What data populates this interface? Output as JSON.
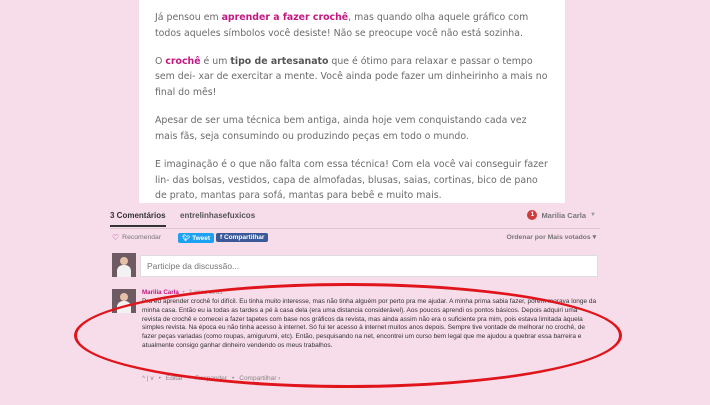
{
  "article": {
    "p1_a": "Já pensou em ",
    "p1_b": "aprender a fazer crochê",
    "p1_c": ", mas quando olha aquele gráfico com todos aqueles símbolos você desiste! Não se preocupe você não está sozinha.",
    "p2_a": "O ",
    "p2_b": "crochê",
    "p2_c": " é um ",
    "p2_d": "tipo de artesanato",
    "p2_e": " que é ótimo para relaxar e passar o tempo sem dei- xar de exercitar a mente. Você ainda pode fazer um dinheirinho a mais no final do mês!",
    "p3": "Apesar de ser uma técnica bem antiga, ainda hoje vem conquistando cada vez mais fãs, seja consumindo ou produzindo peças em todo o mundo.",
    "p4": "E imaginação é o que não falta com essa técnica! Com ela você vai conseguir fazer lin- das bolsas, vestidos, capa de almofadas, blusas, saias, cortinas, bico de pano de prato, mantas para sofá, mantas para bebê e muito mais."
  },
  "comments": {
    "tab_count": "3 Comentários",
    "tab_site": "entrelinhasefuxicos",
    "notif_count": "1",
    "user_name": "Marilia Carla",
    "recommend_label": "Recomendar",
    "tweet_label": "Tweet",
    "share_label": "Compartilhar",
    "sort_label": "Ordenar por Mais votados",
    "compose_placeholder": "Participe da discussão...",
    "comment": {
      "author": "Marilia Carla",
      "time": "2 anos atrás",
      "body": "Pra eu aprender crochê foi difícil. Eu tinha muito interesse, mas não tinha alguém por perto pra me ajudar. A minha prima sabia fazer, porém morava longe da minha casa. Então eu ia todas as tardes a pé à casa dela (era uma distancia considerável). Aos poucos aprendi os pontos básicos. Depois adquiri uma revista de crochê e comecei a fazer tapetes com base nos gráficos da revista, mas ainda assim não era o suficiente pra mim, pois estava limitada àquela simples revista. Na época eu não tinha acesso à internet. Só fui ter acesso à internet muitos anos depois. Sempre tive vontade de melhorar no crochê, de fazer peças variadas (como roupas, amigurumi, etc). Então, pesquisando na net, encontrei um curso bem legal que me ajudou a quebrar essa barreira e atualmente consigo ganhar dinheiro vendendo os meus trabalhos.",
      "votes": "^ | v",
      "edit_label": "Editar",
      "reply_label": "Responder",
      "share_label": "Compartilhar ›"
    }
  },
  "colors": {
    "accent": "#c2187f",
    "background": "#f7dce9",
    "annotation": "#e0141b"
  }
}
